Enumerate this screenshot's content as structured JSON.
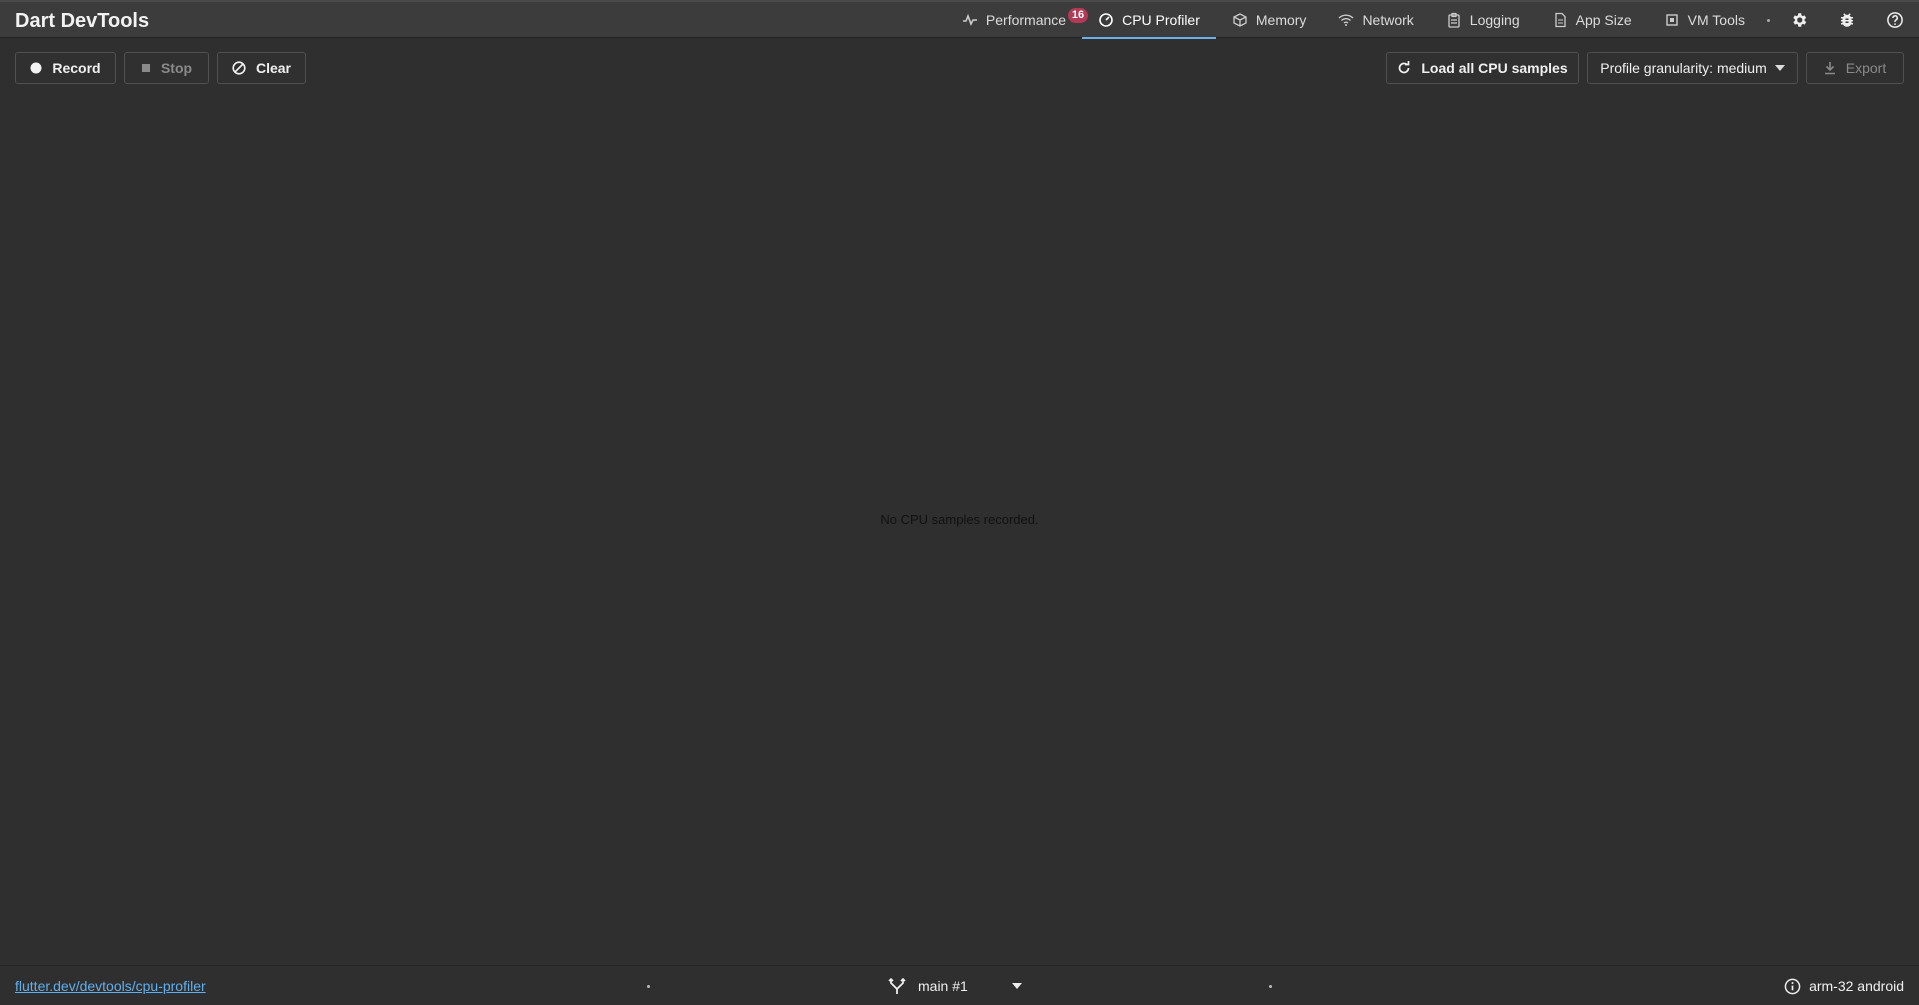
{
  "app": {
    "title": "Dart DevTools"
  },
  "tabs": [
    {
      "label": "Performance",
      "icon": "pulse-icon",
      "badge": "16",
      "active": false
    },
    {
      "label": "CPU Profiler",
      "icon": "gauge-icon",
      "active": true
    },
    {
      "label": "Memory",
      "icon": "box-icon",
      "active": false
    },
    {
      "label": "Network",
      "icon": "wifi-icon",
      "active": false
    },
    {
      "label": "Logging",
      "icon": "clipboard-icon",
      "active": false
    },
    {
      "label": "App Size",
      "icon": "file-icon",
      "active": false
    },
    {
      "label": "VM Tools",
      "icon": "chip-icon",
      "active": false
    }
  ],
  "header_icons": [
    "gear-icon",
    "bug-icon",
    "help-icon"
  ],
  "toolbar": {
    "record_label": "Record",
    "stop_label": "Stop",
    "clear_label": "Clear",
    "load_all_label": "Load all CPU samples",
    "granularity_label": "Profile granularity: medium",
    "export_label": "Export"
  },
  "main": {
    "empty_message": "No CPU samples recorded."
  },
  "footer": {
    "link": "flutter.dev/devtools/cpu-profiler",
    "isolate": "main #1",
    "device": "arm-32 android"
  },
  "colors": {
    "background": "#2f2f2f",
    "header": "#3c3c3c",
    "accent": "#6cb0e8",
    "badge": "#b33a56",
    "link": "#5fb0f0"
  }
}
